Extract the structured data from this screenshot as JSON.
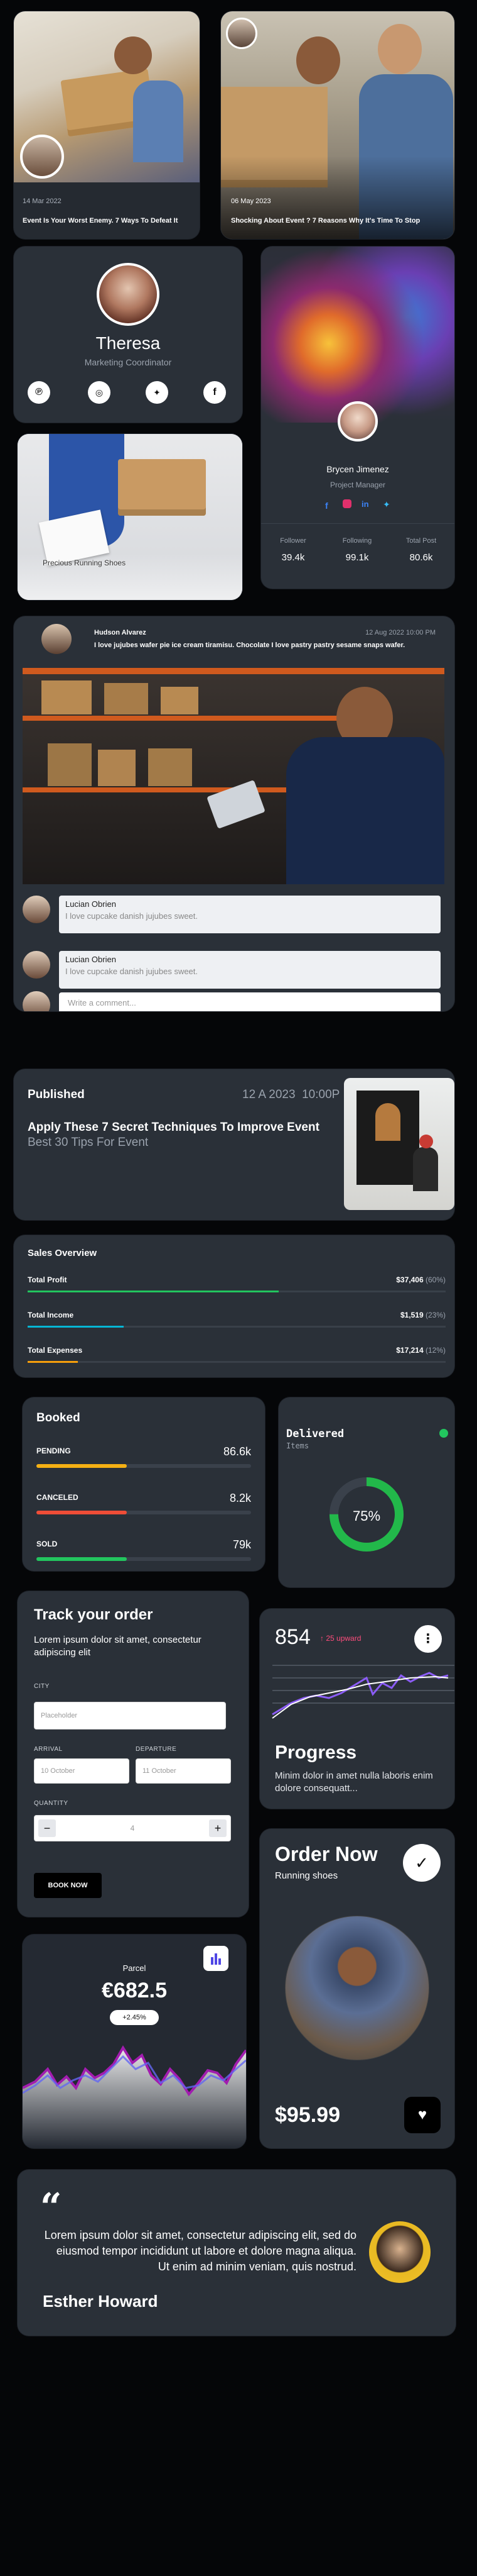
{
  "blog_card_1": {
    "date": "14 Mar 2022",
    "title": "Event Is Your Worst Enemy. 7 Ways To Defeat It"
  },
  "blog_card_2": {
    "date": "06 May 2023",
    "title": "Shocking About Event ? 7 Reasons Why It's Time To Stop"
  },
  "profile_teresa": {
    "name": "Theresa",
    "role": "Marketing Coordinator",
    "socials": [
      "pinterest-icon",
      "instagram-icon",
      "twitter-icon",
      "facebook-icon"
    ]
  },
  "product_card": {
    "title": "Precious Running Shoes"
  },
  "profile_brycen": {
    "name": "Brycen Jimenez",
    "role": "Project Manager",
    "socials": [
      "facebook-icon",
      "instagram-icon",
      "linkedin-icon",
      "twitter-icon"
    ],
    "stats": [
      {
        "label": "Follower",
        "value": "39.4k"
      },
      {
        "label": "Following",
        "value": "99.1k"
      },
      {
        "label": "Total Post",
        "value": "80.6k"
      }
    ]
  },
  "post": {
    "author": "Hudson Alvarez",
    "timestamp": "12 Aug 2022 10:00 PM",
    "text": "I love jujubes wafer pie ice cream tiramisu. Chocolate I love pastry pastry sesame snaps wafer.",
    "comments": [
      {
        "author": "Lucian Obrien",
        "text": "I love cupcake danish jujubes sweet."
      },
      {
        "author": "Lucian Obrien",
        "text": "I love cupcake danish jujubes sweet."
      }
    ],
    "comment_placeholder": "Write a comment..."
  },
  "published": {
    "label": "Published",
    "date": "12 A 2023  10:00P",
    "title": "Apply These 7 Secret Techniques To Improve Event",
    "subtitle": "Best 30 Tips For Event"
  },
  "sales": {
    "title": "Sales Overview",
    "rows": [
      {
        "label": "Total Profit",
        "amount": "$37,406",
        "percent": "(60%)",
        "fill": 0.6,
        "color": "#22c55e"
      },
      {
        "label": "Total Income",
        "amount": "$1,519",
        "percent": "(23%)",
        "fill": 0.23,
        "color": "#06b6d4"
      },
      {
        "label": "Total Expenses",
        "amount": "$17,214",
        "percent": "(12%)",
        "fill": 0.12,
        "color": "#f59e0b"
      }
    ]
  },
  "booked": {
    "title": "Booked",
    "rows": [
      {
        "label": "PENDING",
        "value": "86.6k",
        "fill": 0.42,
        "color": "#f5b014"
      },
      {
        "label": "CANCELED",
        "value": "8.2k",
        "fill": 0.42,
        "color": "#ef4d37"
      },
      {
        "label": "SOLD",
        "value": "79k",
        "fill": 0.42,
        "color": "#22c55e"
      }
    ]
  },
  "delivered": {
    "title": "Delivered",
    "subtitle": "Items",
    "percent_label": "75%",
    "percent": 0.75
  },
  "track": {
    "title": "Track your  order",
    "desc": "Lorem ipsum dolor sit amet, consectetur adipiscing elit",
    "city_label": "CITY",
    "city_placeholder": "Placeholder",
    "arrival_label": "ARRIVAL",
    "arrival_value": "10 October",
    "departure_label": "DEPARTURE",
    "departure_value": "11 October",
    "quantity_label": "QUANTITY",
    "quantity_value": "4",
    "book_label": "BOOK NOW"
  },
  "progress": {
    "number": "854",
    "trend": "↑ 25 upward",
    "title": "Progress",
    "desc": "Minim dolor in amet nulla laboris enim dolore consequatt..."
  },
  "parcel": {
    "label": "Parcel",
    "amount": "€682.5",
    "change": "+2.45%"
  },
  "order": {
    "title": "Order Now",
    "subtitle": "Running shoes",
    "price": "$95.99"
  },
  "testimonial": {
    "quote": "Lorem ipsum dolor sit amet, consectetur adipiscing elit, sed do eiusmod tempor incididunt ut labore et dolore magna aliqua. Ut enim ad minim veniam, quis nostrud.",
    "author": "Esther Howard"
  }
}
